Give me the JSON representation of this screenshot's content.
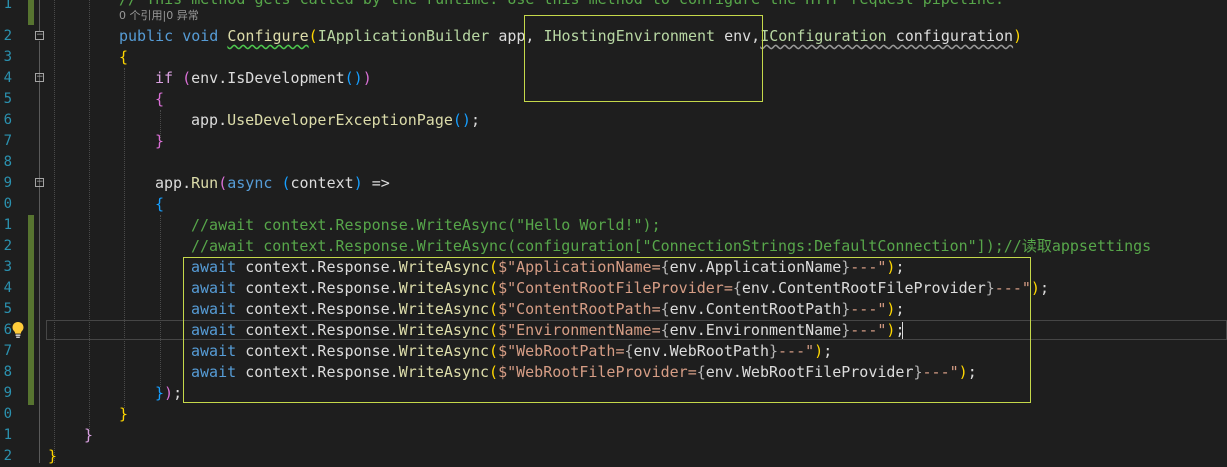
{
  "editor": {
    "line_numbers": [
      "1",
      "2",
      "3",
      "4",
      "5",
      "6",
      "7",
      "8",
      "9",
      "0",
      "1",
      "2",
      "3",
      "4",
      "5",
      "6",
      "7",
      "8",
      "9",
      "0",
      "1",
      "2"
    ],
    "codelens": "0 个引用|0 异常",
    "top_comment": "// This method gets called by the runtime. Use this method to configure the HTTP request pipeline.",
    "signature": {
      "modifiers": "public void",
      "name": "Configure",
      "param1_type": "IApplicationBuilder",
      "param1_name": "app,",
      "param2_type": "IHostingEnvironment",
      "param2_name": "env,",
      "param3_type": "IConfiguration",
      "param3_name": "configuration"
    },
    "if_keyword": "if",
    "if_condition": "env.IsDevelopment",
    "dev_call_prefix": "app.",
    "dev_call_method": "UseDeveloperExceptionPage",
    "run_prefix": "app.",
    "run_method": "Run",
    "async_keyword": "async",
    "context_param": "context",
    "lambda_arrow": "=>",
    "comment_hello": "//await context.Response.WriteAsync(\"Hello World!\");",
    "comment_config": "//await context.Response.WriteAsync(configuration[\"ConnectionStrings:DefaultConnection\"]);//读取appsettings",
    "await_keyword": "await",
    "write_call": "context.Response.",
    "write_method": "WriteAsync",
    "write_lines": [
      {
        "label": "ApplicationName=",
        "expr": "env.ApplicationName"
      },
      {
        "label": "ContentRootFileProvider=",
        "expr": "env.ContentRootFileProvider"
      },
      {
        "label": "ContentRootPath=",
        "expr": "env.ContentRootPath"
      },
      {
        "label": "EnvironmentName=",
        "expr": "env.EnvironmentName"
      },
      {
        "label": "WebRootPath=",
        "expr": "env.WebRootPath"
      },
      {
        "label": "WebRootFileProvider=",
        "expr": "env.WebRootFileProvider"
      }
    ],
    "string_suffix": "---\"",
    "closing_run": "});",
    "lightbulb_icon": "lightbulb-icon"
  }
}
